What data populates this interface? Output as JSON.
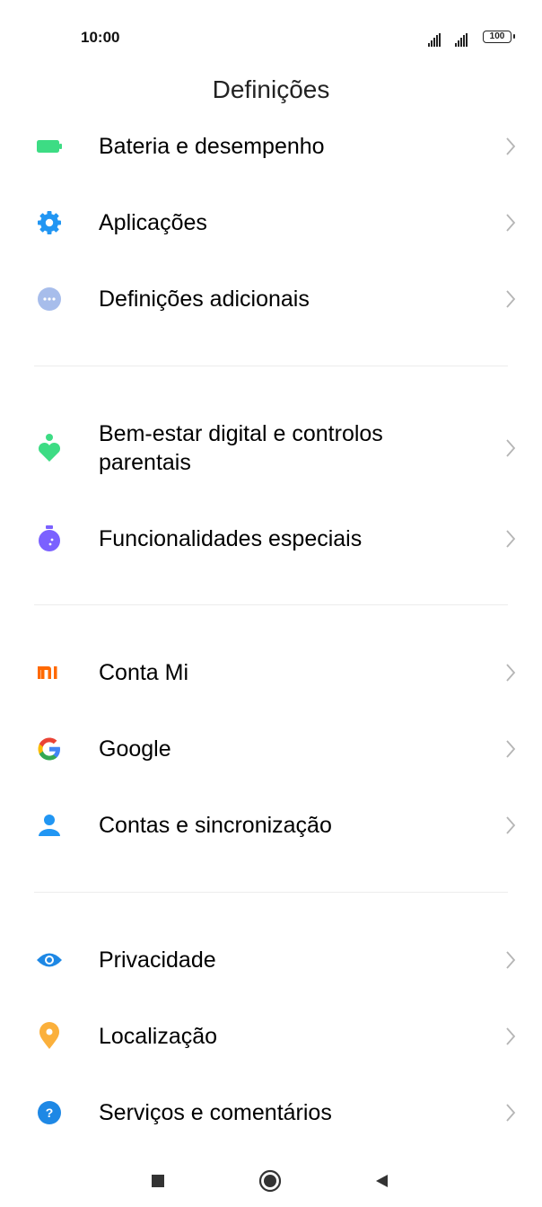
{
  "status_bar": {
    "time": "10:00",
    "battery": "100"
  },
  "header": {
    "title": "Definições"
  },
  "sections": [
    {
      "items": [
        {
          "label": "Bateria e desempenho",
          "icon": "battery-icon",
          "color": "#3DDC84"
        },
        {
          "label": "Aplicações",
          "icon": "gear-icon",
          "color": "#2196F3"
        },
        {
          "label": "Definições adicionais",
          "icon": "more-dots-icon",
          "color": "#9BB3E6"
        }
      ]
    },
    {
      "items": [
        {
          "label": "Bem-estar digital e controlos parentais",
          "icon": "digital-wellbeing-icon",
          "color": "#3DDC84"
        },
        {
          "label": "Funcionalidades especiais",
          "icon": "special-features-icon",
          "color": "#7B61FF"
        }
      ]
    },
    {
      "items": [
        {
          "label": "Conta Mi",
          "icon": "mi-logo-icon",
          "color": "#FF6900"
        },
        {
          "label": "Google",
          "icon": "google-icon",
          "color": "#4285F4"
        },
        {
          "label": "Contas e sincronização",
          "icon": "person-icon",
          "color": "#2196F3"
        }
      ]
    },
    {
      "items": [
        {
          "label": "Privacidade",
          "icon": "eye-icon",
          "color": "#1E88E5"
        },
        {
          "label": "Localização",
          "icon": "location-pin-icon",
          "color": "#FBB03B"
        },
        {
          "label": "Serviços e comentários",
          "icon": "help-icon",
          "color": "#1E88E5"
        }
      ]
    }
  ],
  "nav_bar": {
    "buttons": [
      "recents-icon",
      "home-icon",
      "back-icon"
    ]
  }
}
